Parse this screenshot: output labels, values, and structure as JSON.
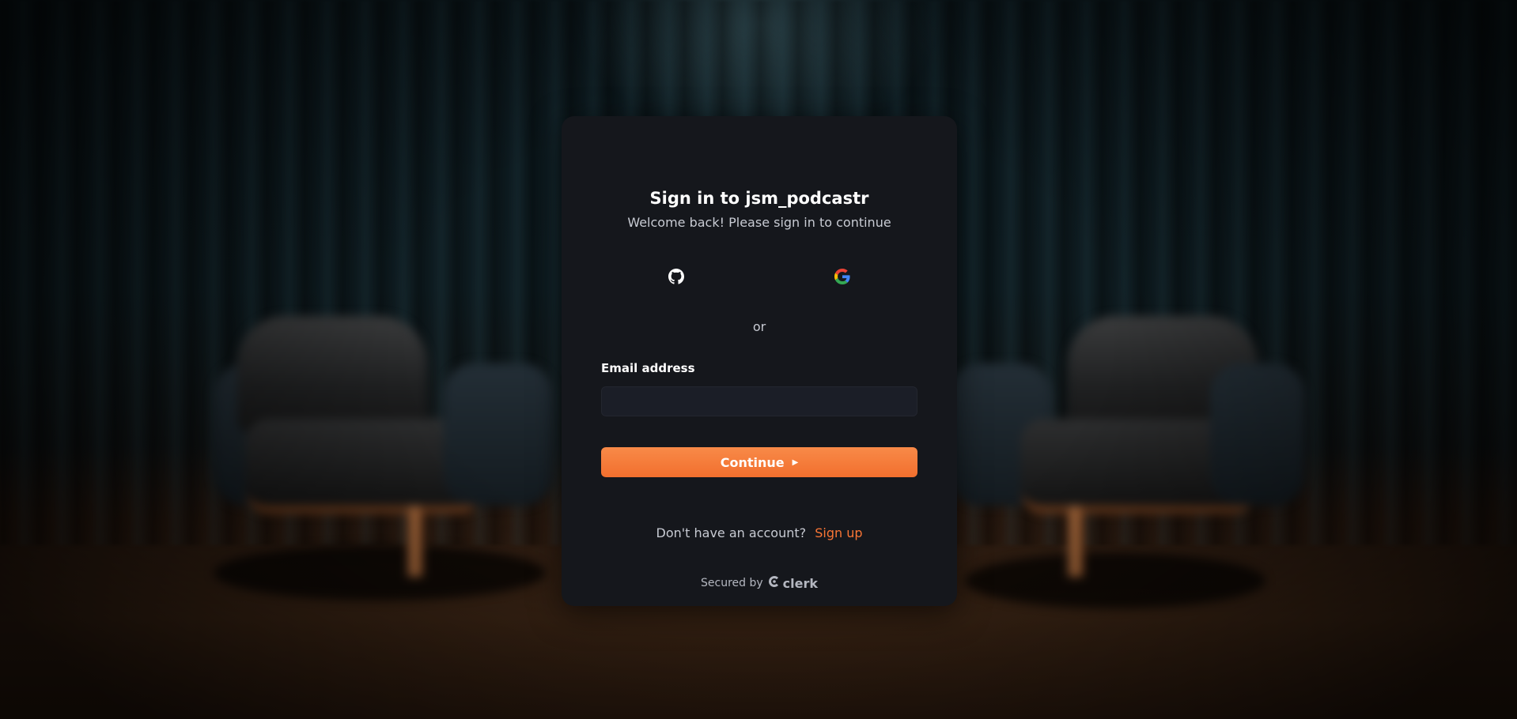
{
  "card": {
    "title": "Sign in to jsm_podcastr",
    "subtitle": "Welcome back! Please sign in to continue",
    "social": [
      {
        "name": "GitHub",
        "icon": "github-icon"
      },
      {
        "name": "Google",
        "icon": "google-icon"
      }
    ],
    "divider_text": "or",
    "email_label": "Email address",
    "email_value": "",
    "continue_label": "Continue",
    "signup_prompt": "Don't have an account?",
    "signup_link": "Sign up",
    "secured_by": "Secured by",
    "brand": "clerk"
  },
  "colors": {
    "accent": "#f97535",
    "card_bg": "#15171c",
    "input_bg": "#1b1e27"
  }
}
